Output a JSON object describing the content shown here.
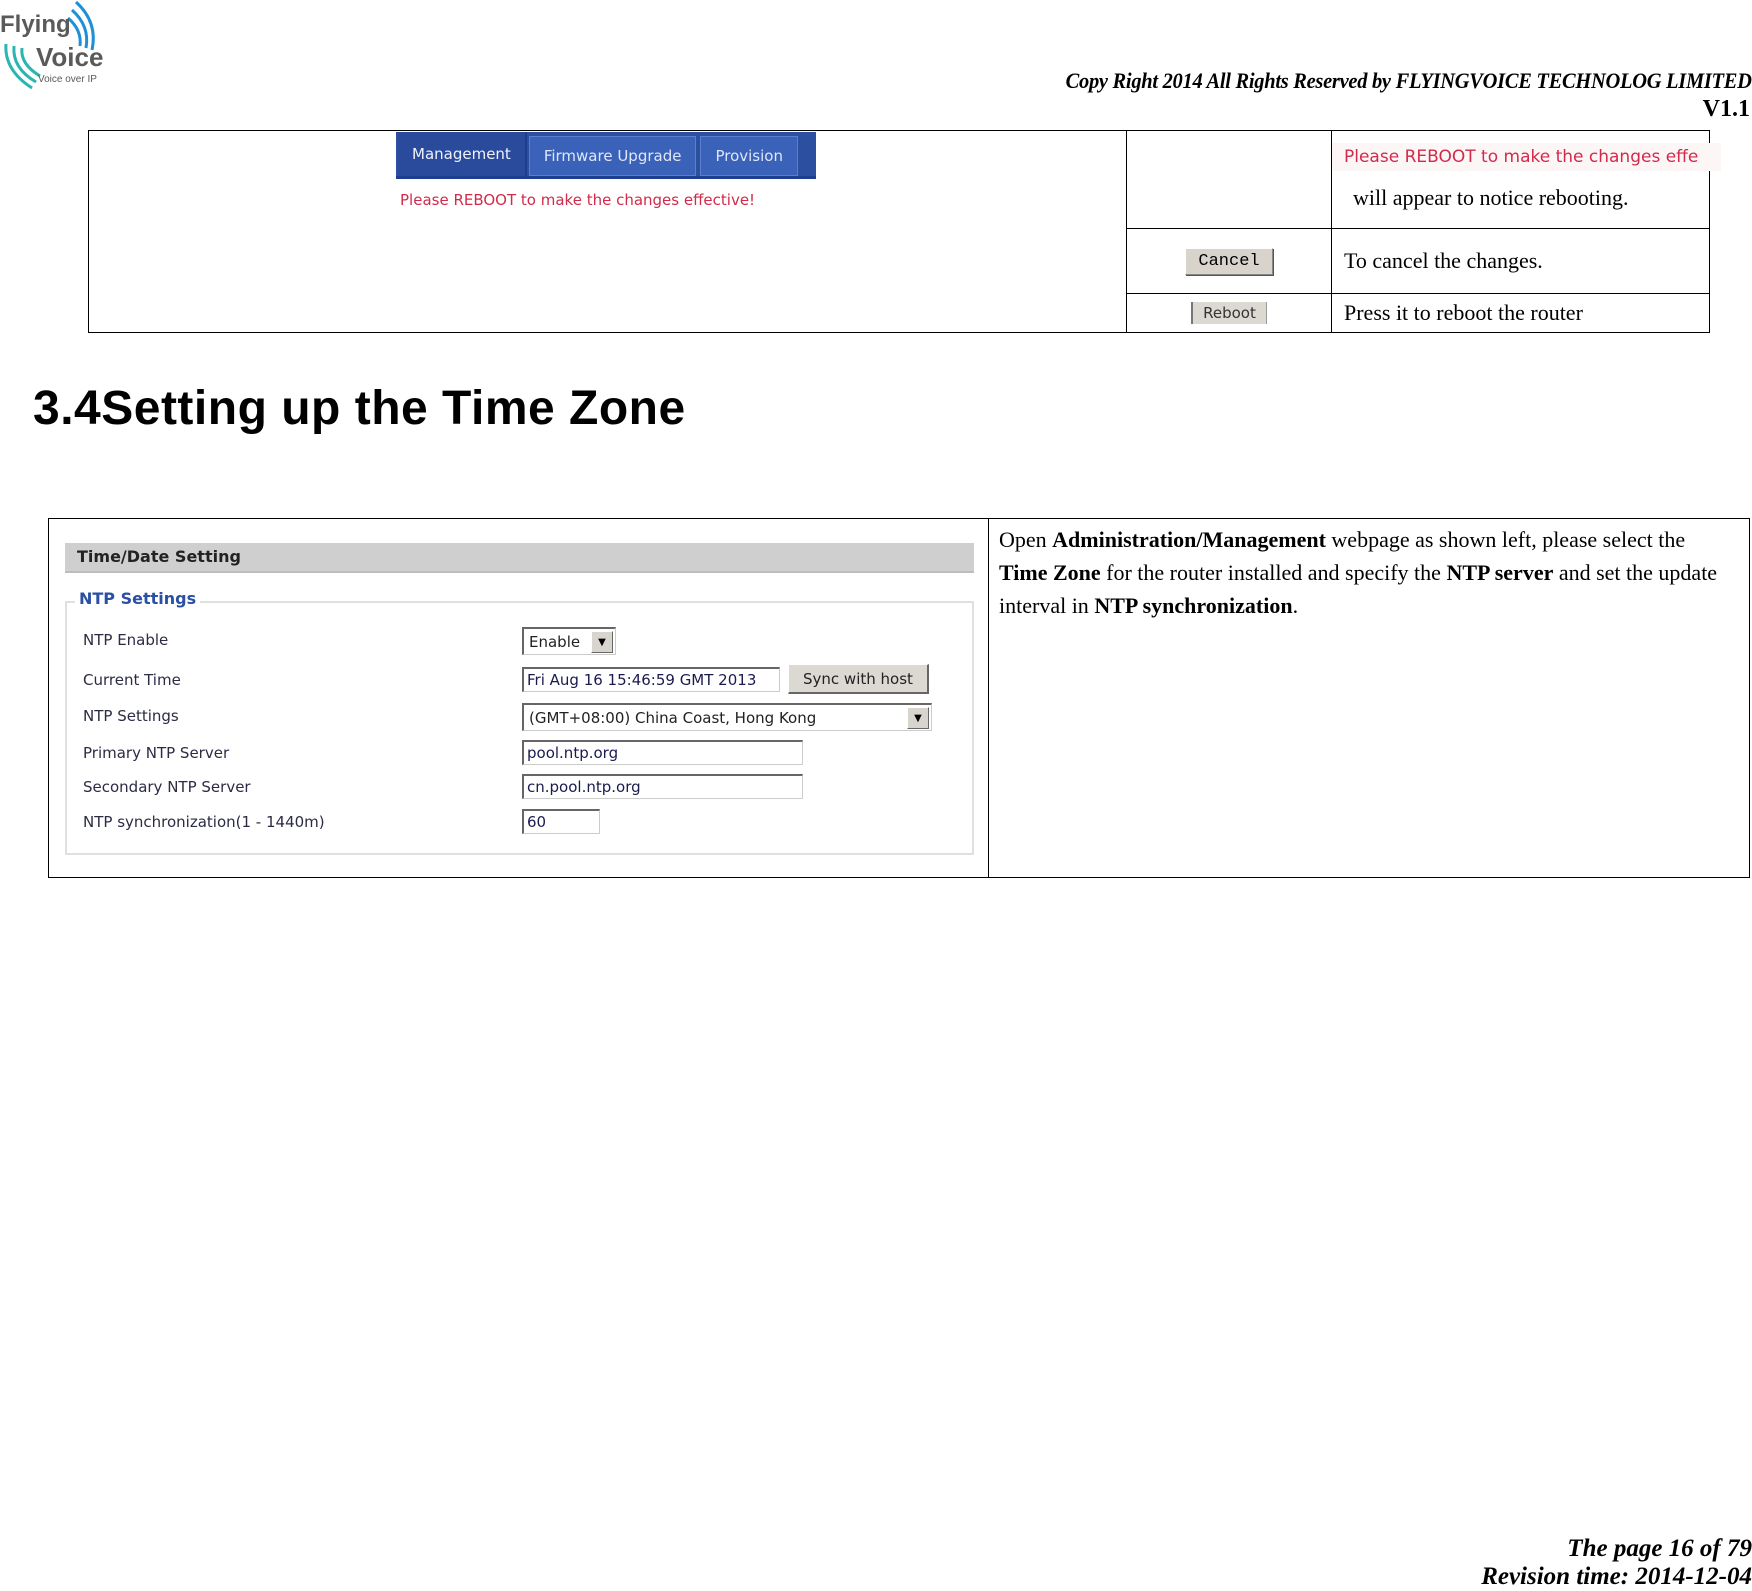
{
  "header": {
    "logo": {
      "line1": "Flying",
      "line2": "Voice",
      "tagline": "Voice over IP",
      "icon": "signal-waves-icon",
      "colors": {
        "text": "#5a5a5a",
        "wave_blue": "#1f8fd6",
        "wave_teal": "#2bb5b0"
      }
    },
    "copyright": "Copy Right 2014 All Rights Reserved by FLYINGVOICE TECHNOLOG LIMITED",
    "version": "V1.1"
  },
  "reboot_table": {
    "screenshot": {
      "tabs": [
        {
          "label": "Management",
          "active": true
        },
        {
          "label": "Firmware Upgrade",
          "active": false
        },
        {
          "label": "Provision",
          "active": false
        }
      ],
      "message": "Please REBOOT to make the changes effective!"
    },
    "rows": [
      {
        "control_image_text": "Please REBOOT to make the changes effe",
        "description": "will appear to notice rebooting."
      },
      {
        "control": "Cancel",
        "description": "To cancel the changes."
      },
      {
        "control": "Reboot",
        "description": "Press it to reboot the router"
      }
    ],
    "colors": {
      "tab_bg": "#2c4fa0",
      "message_red": "#d22a4a"
    }
  },
  "section": {
    "number": "3.4",
    "title": "Setting up the Time Zone"
  },
  "time_table": {
    "panel": {
      "title": "Time/Date Setting",
      "fieldset_legend": "NTP Settings",
      "fields": [
        {
          "label": "NTP Enable",
          "type": "select",
          "value": "Enable"
        },
        {
          "label": "Current Time",
          "type": "text",
          "value": "Fri Aug 16 15:46:59 GMT 2013",
          "button": "Sync with host"
        },
        {
          "label": "NTP Settings",
          "type": "select",
          "value": "(GMT+08:00) China Coast, Hong Kong"
        },
        {
          "label": "Primary NTP Server",
          "type": "text",
          "value": "pool.ntp.org"
        },
        {
          "label": "Secondary NTP Server",
          "type": "text",
          "value": "cn.pool.ntp.org"
        },
        {
          "label": "NTP synchronization(1 - 1440m)",
          "type": "text",
          "value": "60"
        }
      ]
    },
    "description": {
      "p1": "Open ",
      "b1": "Administration/Management",
      "p2": " webpage as shown left, please select the ",
      "b2": "Time Zone",
      "p3": " for the router installed and specify the ",
      "b3": "NTP server",
      "p4": " and set the update interval in ",
      "b4": "NTP synchronization",
      "p5": "."
    }
  },
  "footer": {
    "page": "The page 16 of 79",
    "revision": "Revision time: 2014-12-04"
  }
}
